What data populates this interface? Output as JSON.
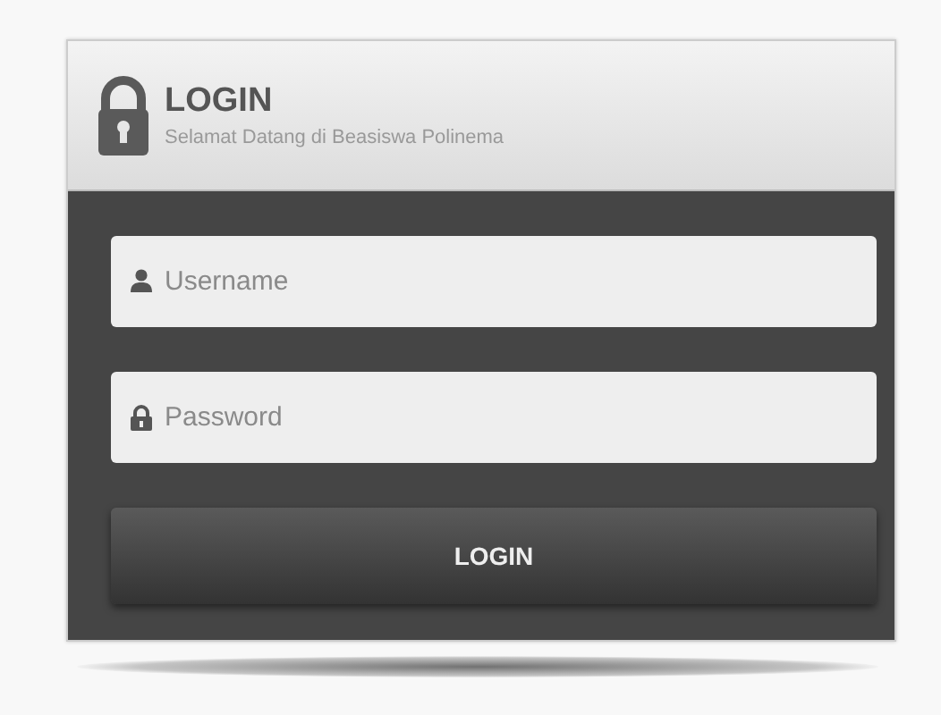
{
  "header": {
    "title": "LOGIN",
    "subtitle": "Selamat Datang di Beasiswa Polinema"
  },
  "fields": [
    {
      "kind": "user",
      "placeholder": "Username"
    },
    {
      "kind": "password",
      "placeholder": "Password"
    }
  ],
  "button": {
    "label": "LOGIN"
  }
}
